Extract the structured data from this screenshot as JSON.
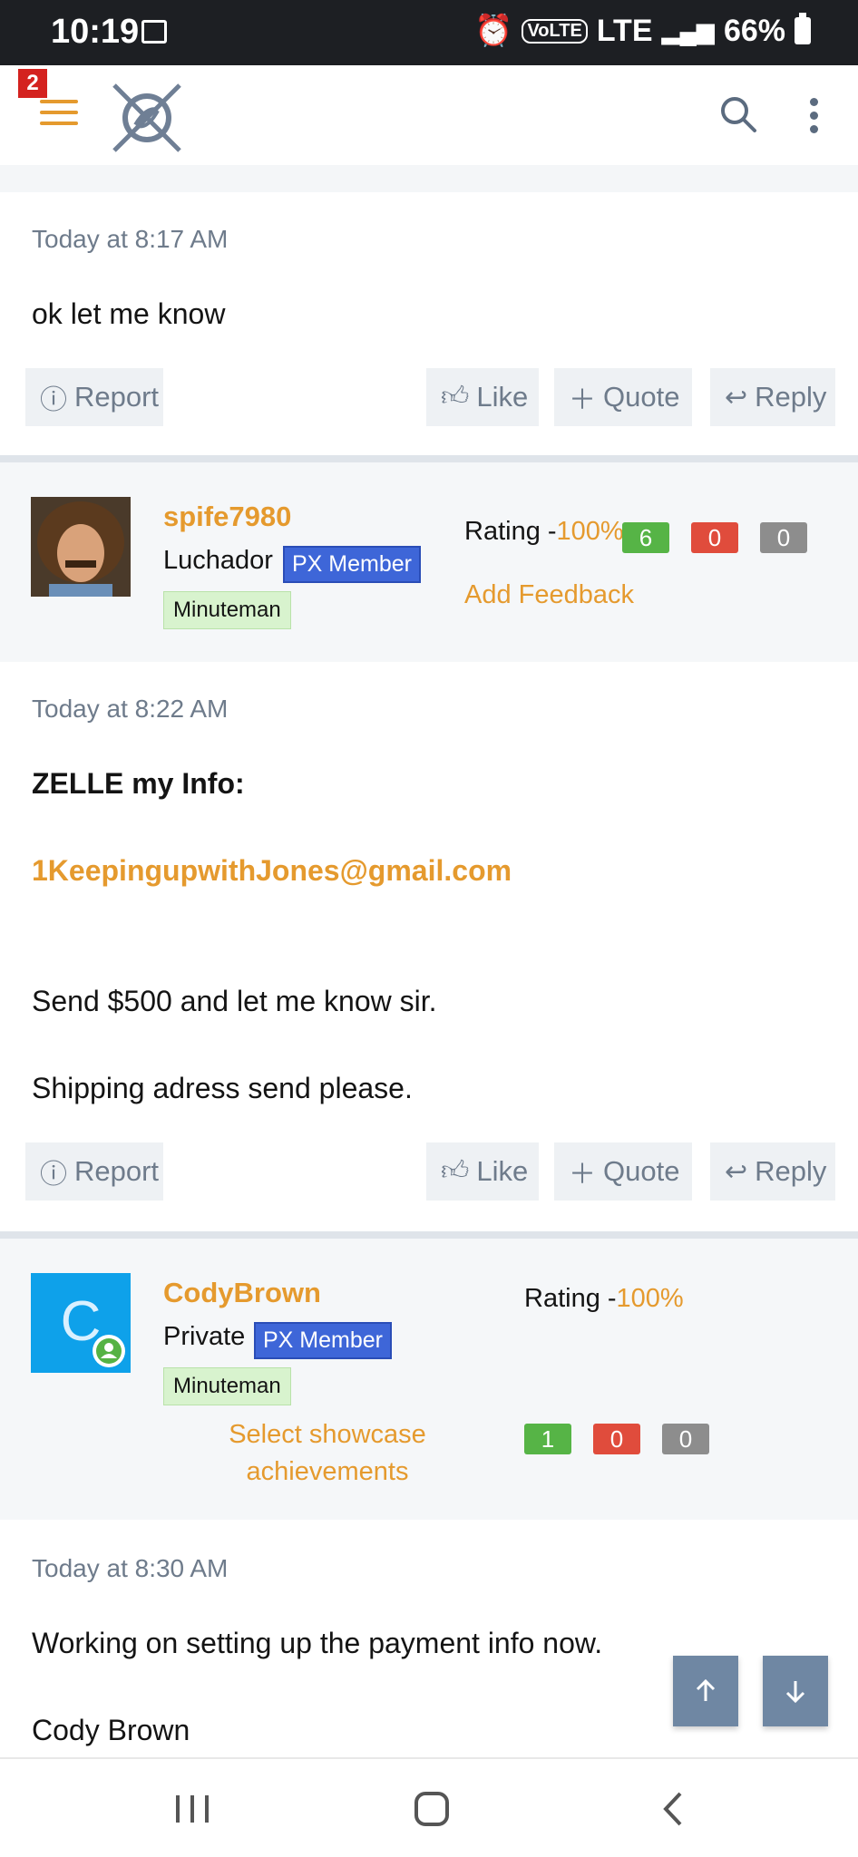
{
  "status": {
    "time": "10:19",
    "network": "LTE",
    "volte": "VoLTE",
    "battery": "66%"
  },
  "header": {
    "notifications": "2"
  },
  "posts": [
    {
      "date": "Today at 8:17 AM",
      "body": "ok let me know"
    },
    {
      "date": "Today at 8:22 AM",
      "heading": "ZELLE my Info:",
      "email": "1KeepingupwithJones@gmail.com",
      "line1": "Send $500 and let me know sir.",
      "line2": "Shipping adress send please."
    },
    {
      "date": "Today at 8:30 AM",
      "line1": "Working on setting up the payment info now.",
      "line2": "Cody Brown"
    }
  ],
  "actions": {
    "report": "Report",
    "like": "Like",
    "quote": "Quote",
    "reply": "Reply"
  },
  "users": [
    {
      "name": "spife7980",
      "title": "Luchador",
      "badge": "PX Member",
      "rank": "Minuteman",
      "rating_label": "Rating -",
      "rating_pct": "100%",
      "pos": "6",
      "neg": "0",
      "neu": "0",
      "feedback": "Add Feedback"
    },
    {
      "name": "CodyBrown",
      "initial": "C",
      "title": "Private",
      "badge": "PX Member",
      "rank": "Minuteman",
      "rating_label": "Rating -",
      "rating_pct": "100%",
      "pos": "1",
      "neg": "0",
      "neu": "0",
      "showcase1": "Select showcase",
      "showcase2": "achievements"
    }
  ],
  "colors": {
    "accent": "#e59a2e",
    "badge_blue": "#3e66d8",
    "scroll_btn": "#6f87a3"
  }
}
